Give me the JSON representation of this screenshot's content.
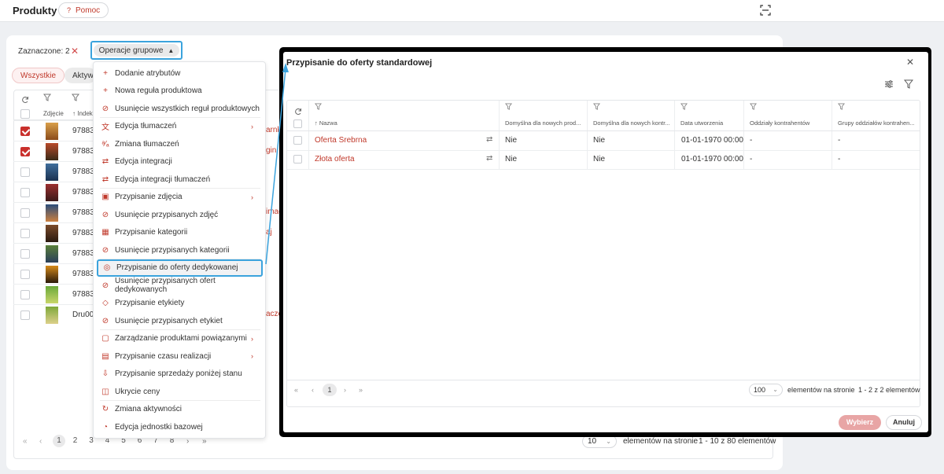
{
  "header": {
    "title": "Produkty",
    "help_label": "Pomoc"
  },
  "toolbar": {
    "selected_text": "Zaznaczone: 2",
    "group_ops_label": "Operacje grupowe"
  },
  "tabs": {
    "all": "Wszystkie",
    "active": "Aktywne"
  },
  "product_table": {
    "col_photo": "Zdjęcie",
    "col_index": "Indeks",
    "rows": [
      {
        "index": "97883",
        "checked": true,
        "peek": "arnk"
      },
      {
        "index": "97883",
        "checked": true,
        "peek": "gin"
      },
      {
        "index": "97883",
        "checked": false,
        "peek": ""
      },
      {
        "index": "97883",
        "checked": false,
        "peek": ""
      },
      {
        "index": "97883",
        "checked": false,
        "peek": "imag"
      },
      {
        "index": "97883",
        "checked": false,
        "peek": "aj"
      },
      {
        "index": "97883",
        "checked": false,
        "peek": ""
      },
      {
        "index": "97883",
        "checked": false,
        "peek": ""
      },
      {
        "index": "97883",
        "checked": false,
        "peek": ""
      },
      {
        "index": "Dru00",
        "checked": false,
        "peek": "acze"
      }
    ],
    "pager": {
      "pages": [
        "1",
        "2",
        "3",
        "4",
        "5",
        "6",
        "7",
        "8"
      ],
      "current": "1",
      "per_page": "10",
      "per_page_label": "elementów na stronie",
      "count": "1 - 10 z 80 elementów"
    }
  },
  "menu": {
    "items": [
      {
        "label": "Dodanie atrybutów",
        "icon": "plus-icon"
      },
      {
        "label": "Nowa reguła produktowa",
        "icon": "plus-icon"
      },
      {
        "label": "Usunięcie wszystkich reguł produktowych",
        "icon": "ban-icon"
      },
      {
        "label": "Edycja tłumaczeń",
        "icon": "translate-icon",
        "submenu": true
      },
      {
        "label": "Zmiana tłumaczeń",
        "icon": "translate-swap-icon"
      },
      {
        "label": "Edycja integracji",
        "icon": "arrows-swap-icon"
      },
      {
        "label": "Edycja integracji tłumaczeń",
        "icon": "arrows-swap-icon"
      },
      {
        "label": "Przypisanie zdjęcia",
        "icon": "image-icon",
        "submenu": true
      },
      {
        "label": "Usunięcie przypisanych zdjęć",
        "icon": "ban-icon"
      },
      {
        "label": "Przypisanie kategorii",
        "icon": "category-icon"
      },
      {
        "label": "Usunięcie przypisanych kategorii",
        "icon": "ban-icon"
      },
      {
        "label": "Przypisanie do oferty dedykowanej",
        "icon": "offer-icon",
        "highlighted": true
      },
      {
        "label": "Usunięcie przypisanych ofert dedykowanych",
        "icon": "ban-icon"
      },
      {
        "label": "Przypisanie etykiety",
        "icon": "tag-icon"
      },
      {
        "label": "Usunięcie przypisanych etykiet",
        "icon": "ban-icon"
      },
      {
        "label": "Zarządzanie produktami powiązanymi",
        "icon": "bag-icon",
        "submenu": true
      },
      {
        "label": "Przypisanie czasu realizacji",
        "icon": "calendar-icon",
        "submenu": true
      },
      {
        "label": "Przypisanie sprzedaży poniżej stanu",
        "icon": "stock-icon"
      },
      {
        "label": "Ukrycie ceny",
        "icon": "price-hide-icon"
      },
      {
        "label": "Zmiana aktywności",
        "icon": "refresh-icon"
      },
      {
        "label": "Edycja jednostki bazowej",
        "icon": "gauge-icon"
      }
    ]
  },
  "modal": {
    "title": "Przypisanie do oferty standardowej",
    "columns": [
      "Nazwa",
      "Domyślna dla nowych prod...",
      "Domyślna dla nowych kontr...",
      "Data utworzenia",
      "Oddziały kontrahentów",
      "Grupy oddziałów kontrahen..."
    ],
    "rows": [
      {
        "name": "Oferta Srebrna",
        "default_products": "Nie",
        "default_contractors": "Nie",
        "created": "01-01-1970 00:00",
        "branches": "-",
        "branch_groups": "-"
      },
      {
        "name": "Złota oferta",
        "default_products": "Nie",
        "default_contractors": "Nie",
        "created": "01-01-1970 00:00",
        "branches": "-",
        "branch_groups": "-"
      }
    ],
    "pager": {
      "current": "1",
      "per_page": "100",
      "per_page_label": "elementów na stronie",
      "count": "1 - 2 z 2 elementów"
    },
    "choose_label": "Wybierz",
    "cancel_label": "Anuluj"
  },
  "colors": {
    "accent": "#c0392b",
    "highlight": "#3ba3dd"
  }
}
